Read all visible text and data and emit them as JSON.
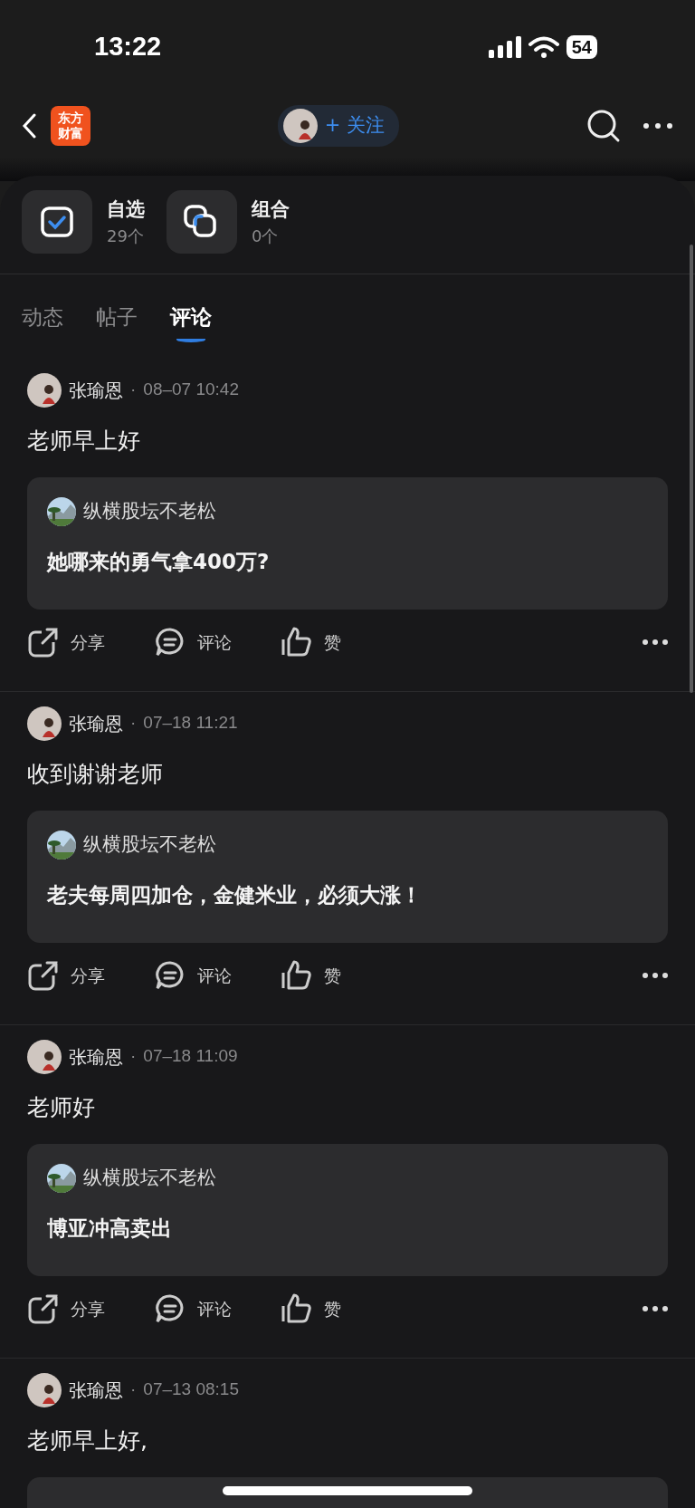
{
  "status_bar": {
    "time": "13:22",
    "battery": "54"
  },
  "header": {
    "logo_lines": [
      "东方",
      "财富"
    ],
    "follow_button": "+ 关注"
  },
  "shortcuts": [
    {
      "kind": "check",
      "title": "自选",
      "count": "29个"
    },
    {
      "kind": "combine",
      "title": "组合",
      "count": "0个"
    }
  ],
  "tabs": [
    {
      "label": "动态",
      "selected": false
    },
    {
      "label": "帖子",
      "selected": false
    },
    {
      "label": "评论",
      "selected": true
    }
  ],
  "posts": [
    {
      "kind": "full",
      "author": "张瑜恩",
      "separator": "·",
      "time": "08–07 10:42",
      "text": "老师早上好",
      "quote": {
        "author": "纵横股坛不老松",
        "text": "她哪来的勇气拿400万?"
      },
      "actions": [
        "分享",
        "评论",
        "赞"
      ]
    },
    {
      "kind": "full",
      "author": "张瑜恩",
      "separator": "·",
      "time": "07–18 11:21",
      "text": "收到谢谢老师",
      "quote": {
        "author": "纵横股坛不老松",
        "text": "老夫每周四加仓，金健米业，必须大涨！"
      },
      "actions": [
        "分享",
        "评论",
        "赞"
      ]
    },
    {
      "kind": "full",
      "author": "张瑜恩",
      "separator": "·",
      "time": "07–18 11:09",
      "text": "老师好",
      "quote": {
        "author": "纵横股坛不老松",
        "text": "博亚冲高卖出"
      },
      "actions": [
        "分享",
        "评论",
        "赞"
      ]
    },
    {
      "kind": "cut",
      "author": "张瑜恩",
      "separator": "·",
      "time": "07–13 08:15",
      "text": "老师早上好,"
    }
  ]
}
